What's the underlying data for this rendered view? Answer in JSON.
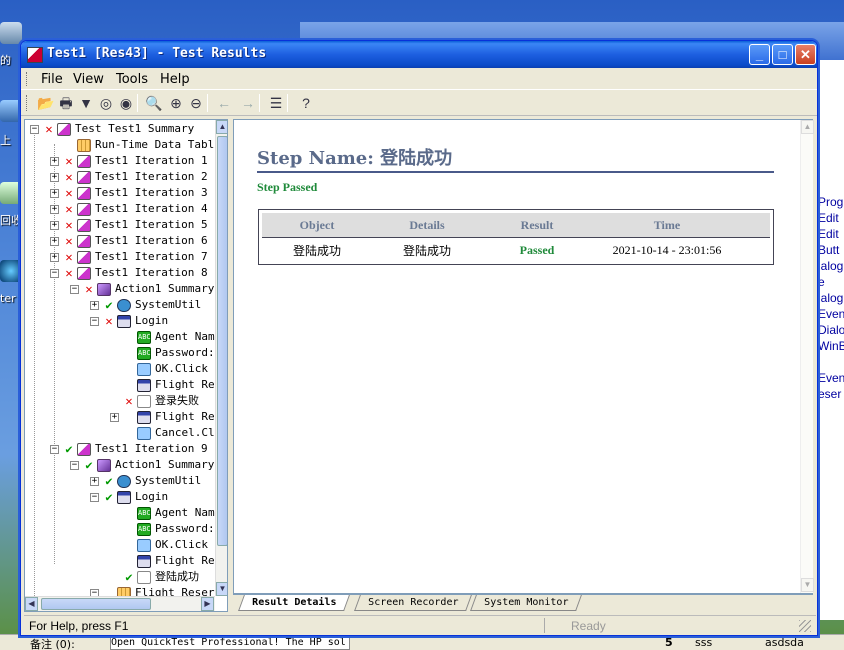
{
  "desktop": {
    "icons": [
      {
        "name": "computer-icon",
        "label": "的"
      },
      {
        "name": "network-icon",
        "label": "上"
      },
      {
        "name": "recycle-icon",
        "label": "回收"
      },
      {
        "name": "ie-icon",
        "label": "ter"
      }
    ],
    "right_panel_text": [
      "Prog",
      "Edit",
      "Edit",
      "Butt",
      "ialog",
      "e",
      "ialog",
      "Even",
      "Dialo",
      "WinB",
      "Even",
      "eser"
    ],
    "bottom_strip": {
      "label": "备注 (0):",
      "text": "Open QuickTest Professional! The HP sol",
      "num": "5",
      "c1": "sss",
      "c2": "asdsda"
    }
  },
  "window": {
    "title": "Test1 [Res43] - Test Results",
    "buttons": {
      "minimize": "_",
      "maximize": "□",
      "close": "✕"
    }
  },
  "menu": {
    "file": "File",
    "view": "View",
    "tools": "Tools",
    "help": "Help"
  },
  "toolbar": {
    "icons": [
      "open-icon",
      "print-icon",
      "filter-icon",
      "find-icon",
      "find-next-icon",
      "zoom-icon",
      "zoom-in-icon",
      "zoom-out-icon",
      "back-icon",
      "forward-icon",
      "collapse-icon",
      "help-icon"
    ],
    "glyphs": [
      "📂",
      "🖶",
      "▼",
      "◎",
      "◉",
      "🔍",
      "⊕",
      "⊖",
      "←",
      "→",
      "☰",
      "?"
    ]
  },
  "tree": {
    "nodes": [
      {
        "level": 0,
        "exp": "−",
        "status": "x",
        "icon": "test",
        "label": "Test Test1 Summary"
      },
      {
        "level": 1,
        "exp": "",
        "status": "",
        "icon": "table",
        "label": "Run-Time Data Tabl"
      },
      {
        "level": 1,
        "exp": "+",
        "status": "x",
        "icon": "test",
        "label": "Test1 Iteration 1"
      },
      {
        "level": 1,
        "exp": "+",
        "status": "x",
        "icon": "test",
        "label": "Test1 Iteration 2"
      },
      {
        "level": 1,
        "exp": "+",
        "status": "x",
        "icon": "test",
        "label": "Test1 Iteration 3"
      },
      {
        "level": 1,
        "exp": "+",
        "status": "x",
        "icon": "test",
        "label": "Test1 Iteration 4"
      },
      {
        "level": 1,
        "exp": "+",
        "status": "x",
        "icon": "test",
        "label": "Test1 Iteration 5"
      },
      {
        "level": 1,
        "exp": "+",
        "status": "x",
        "icon": "test",
        "label": "Test1 Iteration 6"
      },
      {
        "level": 1,
        "exp": "+",
        "status": "x",
        "icon": "test",
        "label": "Test1 Iteration 7"
      },
      {
        "level": 1,
        "exp": "−",
        "status": "x",
        "icon": "test",
        "label": "Test1 Iteration 8"
      },
      {
        "level": 2,
        "exp": "−",
        "status": "x",
        "icon": "action",
        "label": "Action1 Summary"
      },
      {
        "level": 3,
        "exp": "+",
        "status": "ok",
        "icon": "util",
        "label": "SystemUtil"
      },
      {
        "level": 3,
        "exp": "−",
        "status": "x",
        "icon": "dialog",
        "label": "Login"
      },
      {
        "level": 4,
        "exp": "",
        "status": "",
        "icon": "edit",
        "label": "Agent Nam"
      },
      {
        "level": 4,
        "exp": "",
        "status": "",
        "icon": "edit",
        "label": "Password:"
      },
      {
        "level": 4,
        "exp": "",
        "status": "",
        "icon": "btn",
        "label": "OK.Click"
      },
      {
        "level": 4,
        "exp": "",
        "status": "",
        "icon": "dialog",
        "label": "Flight Re"
      },
      {
        "level": 4,
        "exp": "",
        "status": "x",
        "icon": "step",
        "label": "登录失败"
      },
      {
        "level": 4,
        "exp": "+",
        "status": "",
        "icon": "dialog",
        "label": "Flight Re"
      },
      {
        "level": 4,
        "exp": "",
        "status": "",
        "icon": "btn",
        "label": "Cancel.Cl"
      },
      {
        "level": 1,
        "exp": "−",
        "status": "ok",
        "icon": "test",
        "label": "Test1 Iteration 9"
      },
      {
        "level": 2,
        "exp": "−",
        "status": "ok",
        "icon": "action",
        "label": "Action1 Summary"
      },
      {
        "level": 3,
        "exp": "+",
        "status": "ok",
        "icon": "util",
        "label": "SystemUtil"
      },
      {
        "level": 3,
        "exp": "−",
        "status": "ok",
        "icon": "dialog",
        "label": "Login"
      },
      {
        "level": 4,
        "exp": "",
        "status": "",
        "icon": "edit",
        "label": "Agent Nam"
      },
      {
        "level": 4,
        "exp": "",
        "status": "",
        "icon": "edit",
        "label": "Password:"
      },
      {
        "level": 4,
        "exp": "",
        "status": "",
        "icon": "btn",
        "label": "OK.Click"
      },
      {
        "level": 4,
        "exp": "",
        "status": "",
        "icon": "dialog",
        "label": "Flight Re"
      },
      {
        "level": 4,
        "exp": "",
        "status": "ok",
        "icon": "step",
        "label": "登陆成功"
      },
      {
        "level": 3,
        "exp": "−",
        "status": "",
        "icon": "table",
        "label": "Flight Reser"
      }
    ]
  },
  "details": {
    "step_name": "Step Name: 登陆成功",
    "status": "Step Passed",
    "table": {
      "headers": [
        "Object",
        "Details",
        "Result",
        "Time"
      ],
      "row": {
        "object": "登陆成功",
        "details": "登陆成功",
        "result": "Passed",
        "time": "2021-10-14 - 23:01:56"
      }
    }
  },
  "tabs": [
    {
      "label": "Result Details",
      "active": true
    },
    {
      "label": "Screen Recorder",
      "active": false
    },
    {
      "label": "System Monitor",
      "active": false
    }
  ],
  "status": {
    "help": "For Help, press F1",
    "ready": "Ready"
  },
  "colors": {
    "title_blue": "#0a4ac8",
    "pass_green": "#1f8a3a",
    "fail_red": "#dd0000",
    "heading_gray": "#5a6a8a"
  }
}
